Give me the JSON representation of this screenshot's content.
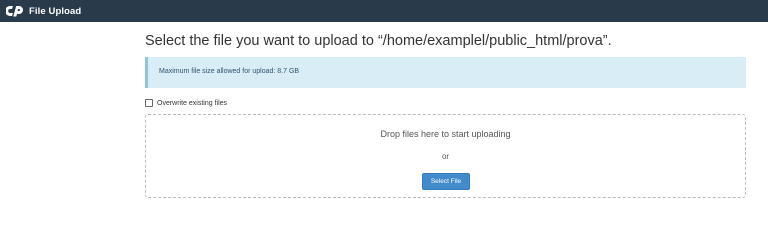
{
  "header": {
    "title": "File Upload",
    "logo_icon": "cpanel-logo-icon"
  },
  "main": {
    "heading": "Select the file you want to upload to “/home/examplel/public_html/prova”.",
    "info_message": "Maximum file size allowed for upload: 8.7 GB",
    "overwrite_label": "Overwrite existing files",
    "overwrite_checked": false,
    "dropzone": {
      "text": "Drop files here to start uploading",
      "or_text": "or",
      "button_label": "Select File"
    }
  },
  "colors": {
    "header_bg": "#293a4a",
    "info_bg": "#d9edf7",
    "button_bg": "#428bca"
  }
}
